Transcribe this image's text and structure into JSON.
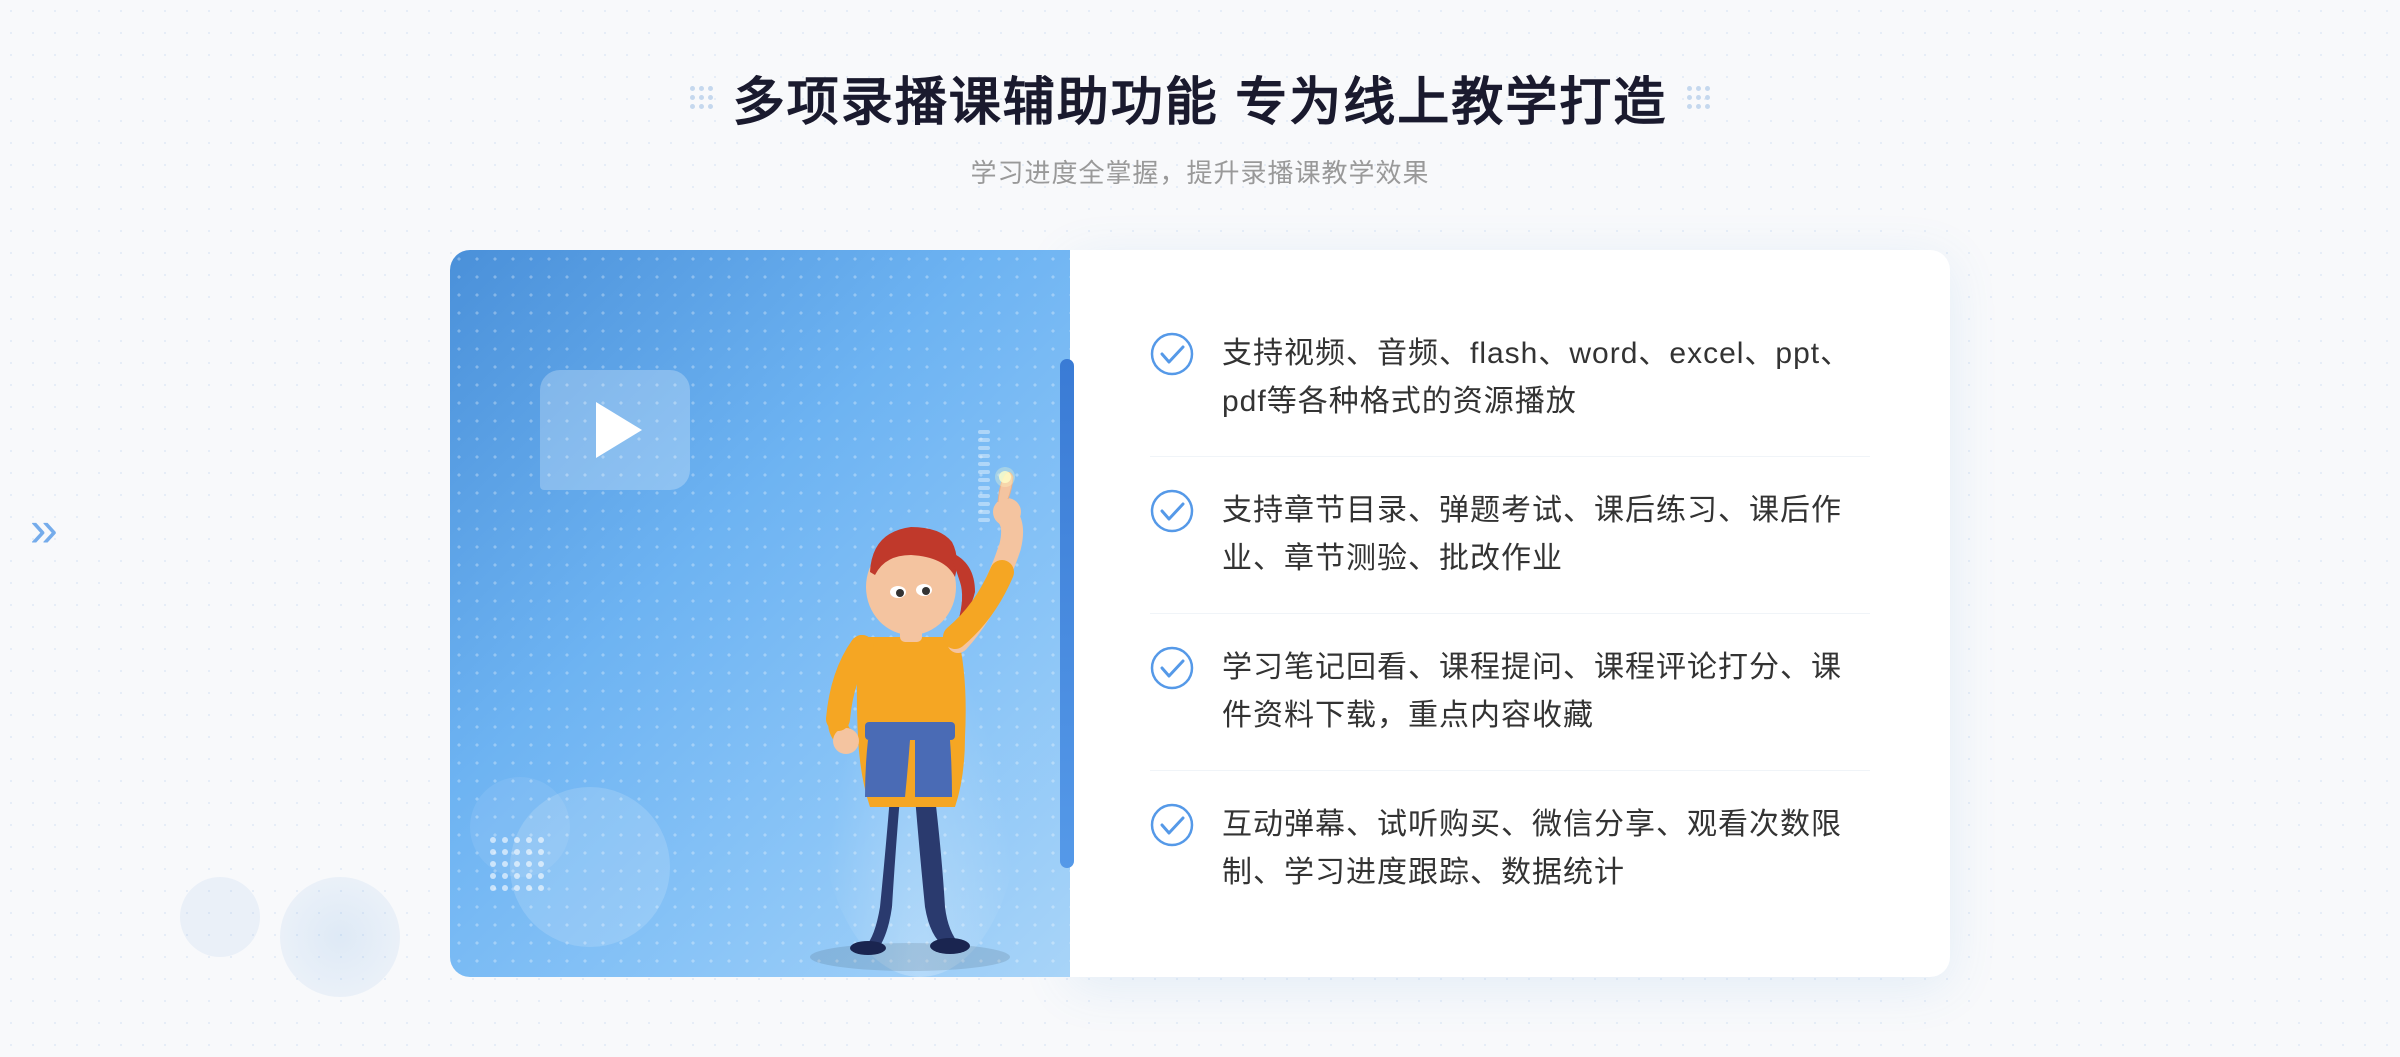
{
  "page": {
    "background_color": "#f8f9fb"
  },
  "header": {
    "title": "多项录播课辅助功能 专为线上教学打造",
    "subtitle": "学习进度全掌握，提升录播课教学效果",
    "decoration_left": "dots",
    "decoration_right": "dots"
  },
  "features": [
    {
      "id": 1,
      "text": "支持视频、音频、flash、word、excel、ppt、pdf等各种格式的资源播放"
    },
    {
      "id": 2,
      "text": "支持章节目录、弹题考试、课后练习、课后作业、章节测验、批改作业"
    },
    {
      "id": 3,
      "text": "学习笔记回看、课程提问、课程评论打分、课件资料下载，重点内容收藏"
    },
    {
      "id": 4,
      "text": "互动弹幕、试听购买、微信分享、观看次数限制、学习进度跟踪、数据统计"
    }
  ],
  "illustration": {
    "play_button": "▶",
    "left_arrow": "»"
  },
  "colors": {
    "accent_blue": "#4a90d9",
    "text_dark": "#1a1a2e",
    "text_gray": "#999999",
    "feature_text": "#333333",
    "check_color": "#5599e8",
    "panel_bg": "#ffffff"
  }
}
